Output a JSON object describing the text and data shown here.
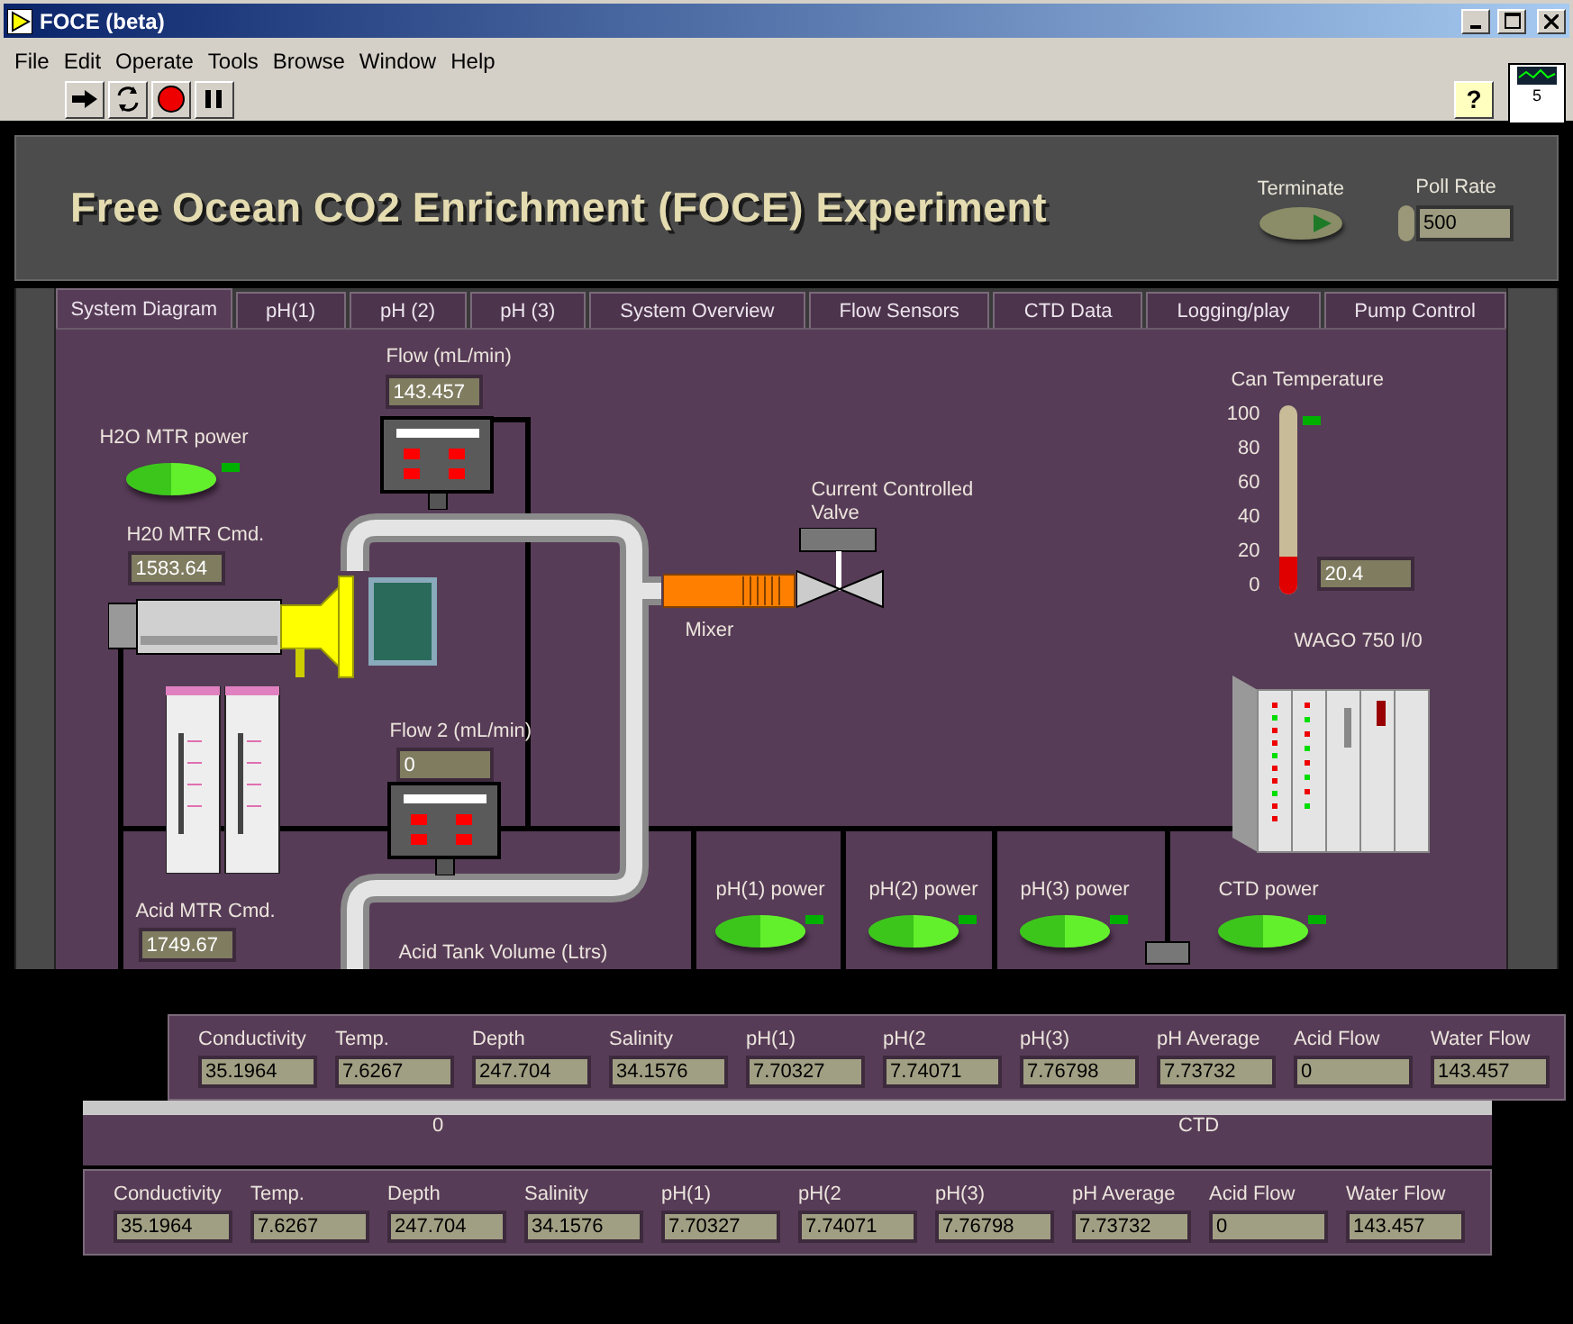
{
  "window": {
    "title": "FOCE (beta)"
  },
  "menu": [
    "File",
    "Edit",
    "Operate",
    "Tools",
    "Browse",
    "Window",
    "Help"
  ],
  "toolbar": {
    "help": "?",
    "vi_number": "5"
  },
  "panel": {
    "title": "Free Ocean CO2 Enrichment (FOCE) Experiment",
    "terminate": {
      "label": "Terminate",
      "on": false
    },
    "poll_rate": {
      "label": "Poll Rate",
      "value": "500"
    }
  },
  "tabs": [
    {
      "label": "System Diagram",
      "selected": true
    },
    {
      "label": "pH(1)",
      "selected": false
    },
    {
      "label": "pH (2)",
      "selected": false
    },
    {
      "label": "pH (3)",
      "selected": false
    },
    {
      "label": "System Overview",
      "selected": false
    },
    {
      "label": "Flow Sensors",
      "selected": false
    },
    {
      "label": "CTD Data",
      "selected": false
    },
    {
      "label": "Logging/play",
      "selected": false
    },
    {
      "label": "Pump Control",
      "selected": false
    }
  ],
  "diagram": {
    "flow": {
      "label": "Flow (mL/min)",
      "value": "143.457"
    },
    "flow_2": {
      "label": "Flow 2 (mL/min)",
      "value": "0"
    },
    "h2o_power": {
      "label": "H2O MTR power",
      "on": true
    },
    "h2o_cmd": {
      "label": "H20 MTR Cmd.",
      "value": "1583.64"
    },
    "acid_cmd": {
      "label": "Acid MTR Cmd.",
      "value": "1749.67"
    },
    "valve_label": "Current Controlled Valve",
    "mixer_label": "Mixer",
    "can_temperature": {
      "label": "Can Temperature",
      "ticks": [
        "100",
        "80",
        "60",
        "40",
        "20",
        "0"
      ],
      "level": 0.204,
      "value": "20.4"
    },
    "wago_label": "WAGO 750 I/0",
    "acid_tank_label": "Acid Tank Volume (Ltrs)",
    "power_switches": [
      {
        "label": "pH(1) power",
        "on": true
      },
      {
        "label": "pH(2) power",
        "on": true
      },
      {
        "label": "pH(3) power",
        "on": true
      },
      {
        "label": "CTD power",
        "on": true
      }
    ]
  },
  "ghost_strip": {
    "tank_zero": "0",
    "ctd": "CTD"
  },
  "readout_panels": [
    [
      {
        "label": "Conductivity",
        "value": "35.1964"
      },
      {
        "label": "Temp.",
        "value": "7.6267"
      },
      {
        "label": "Depth",
        "value": "247.704"
      },
      {
        "label": "Salinity",
        "value": "34.1576"
      },
      {
        "label": "pH(1)",
        "value": "7.70327"
      },
      {
        "label": "pH(2",
        "value": "7.74071"
      },
      {
        "label": "pH(3)",
        "value": "7.76798"
      },
      {
        "label": "pH Average",
        "value": "7.73732"
      },
      {
        "label": "Acid Flow",
        "value": "0"
      },
      {
        "label": "Water Flow",
        "value": "143.457"
      }
    ],
    [
      {
        "label": "Conductivity",
        "value": "35.1964"
      },
      {
        "label": "Temp.",
        "value": "7.6267"
      },
      {
        "label": "Depth",
        "value": "247.704"
      },
      {
        "label": "Salinity",
        "value": "34.1576"
      },
      {
        "label": "pH(1)",
        "value": "7.70327"
      },
      {
        "label": "pH(2",
        "value": "7.74071"
      },
      {
        "label": "pH(3)",
        "value": "7.76798"
      },
      {
        "label": "pH Average",
        "value": "7.73732"
      },
      {
        "label": "Acid Flow",
        "value": "0"
      },
      {
        "label": "Water Flow",
        "value": "143.457"
      }
    ]
  ]
}
